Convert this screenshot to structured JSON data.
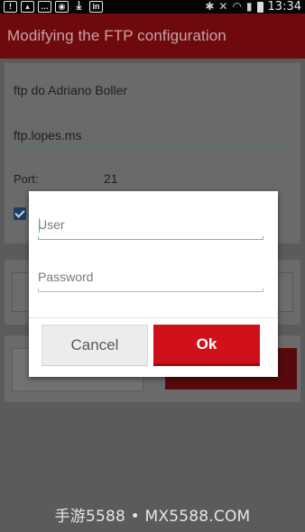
{
  "status_bar": {
    "left_icons": [
      "warning-icon",
      "image-icon",
      "chat-icon",
      "location-icon",
      "download-icon",
      "linkedin-icon"
    ],
    "right_icons": [
      "bluetooth-icon",
      "mute-icon",
      "wifi-icon",
      "signal-icon",
      "battery-icon"
    ],
    "linkedin_text": "in",
    "time": "13:34"
  },
  "action_bar": {
    "title": "Modifying the FTP configuration",
    "color": "#6e0a0d"
  },
  "form": {
    "name_value": "ftp do Adriano Boller",
    "host_value": "ftp.lopes.ms",
    "port_label": "Port:",
    "port_value": "21",
    "checkbox_checked": true
  },
  "dialog": {
    "user_placeholder": "User",
    "password_placeholder": "Password",
    "cancel_label": "Cancel",
    "ok_label": "Ok",
    "ok_color": "#d0111b",
    "accent_line_color": "#6fb8c6"
  },
  "watermark": "手游5588 • MX5588.COM"
}
